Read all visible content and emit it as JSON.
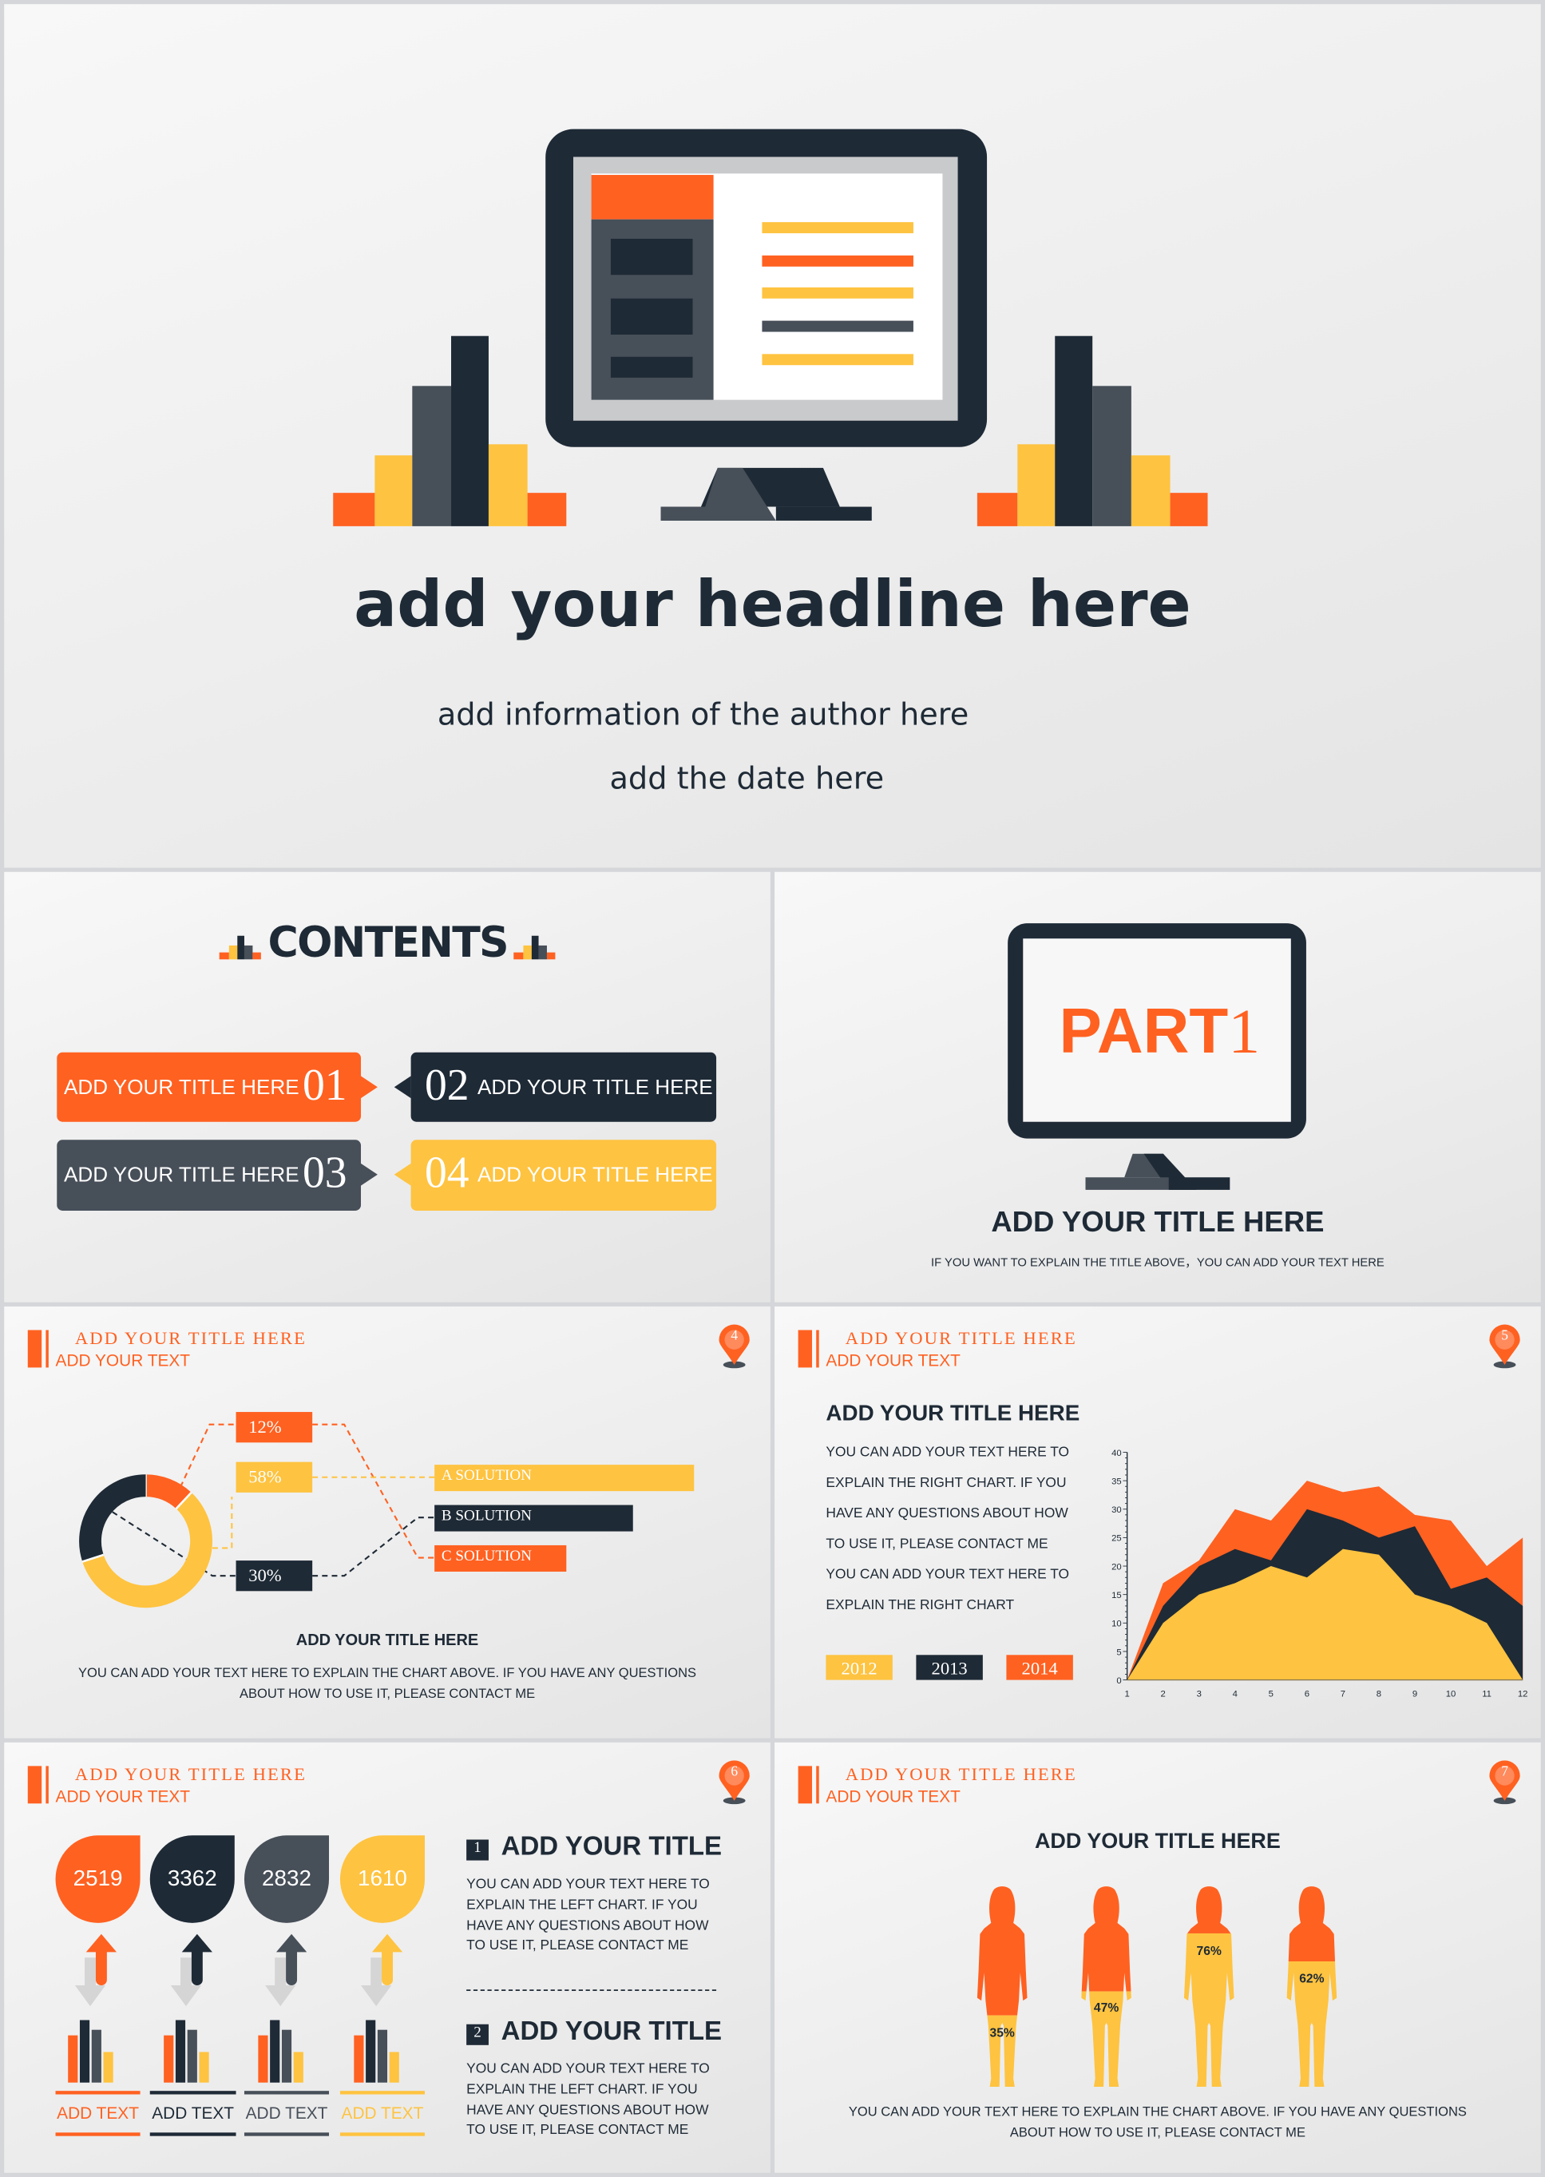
{
  "colors": {
    "orange": "#ff6121",
    "yellow": "#fec340",
    "dark": "#1e2a36",
    "gray": "#474f59"
  },
  "slide1": {
    "headline": "add your headline here",
    "author": "add information of the author here",
    "date": "add the date here"
  },
  "slide2": {
    "title": "CONTENTS",
    "items": [
      {
        "label": "ADD YOUR TITLE HERE",
        "number": "01"
      },
      {
        "label": "ADD YOUR TITLE HERE",
        "number": "02"
      },
      {
        "label": "ADD YOUR TITLE HERE",
        "number": "03"
      },
      {
        "label": "ADD YOUR TITLE HERE",
        "number": "04"
      }
    ]
  },
  "slide3": {
    "part_word": "PART",
    "part_number": "1",
    "title": "ADD YOUR TITLE HERE",
    "subtitle": "IF YOU WANT TO EXPLAIN THE TITLE ABOVE，YOU CAN ADD YOUR TEXT HERE"
  },
  "slide4": {
    "header_title": "ADD YOUR TITLE HERE",
    "header_text": "ADD YOUR TEXT",
    "page_number": "4",
    "solutions": [
      "A SOLUTION",
      "B SOLUTION",
      "C SOLUTION"
    ],
    "title": "ADD YOUR TITLE HERE",
    "text_lines": [
      "YOU CAN ADD YOUR TEXT HERE TO EXPLAIN THE CHART ABOVE. IF YOU HAVE ANY QUESTIONS",
      "ABOUT HOW TO USE IT, PLEASE CONTACT ME"
    ]
  },
  "slide5": {
    "header_title": "ADD YOUR TITLE HERE",
    "header_text": "ADD YOUR TEXT",
    "page_number": "5",
    "title": "ADD YOUR TITLE HERE",
    "text_lines": [
      "YOU CAN ADD YOUR TEXT  HERE  TO",
      "EXPLAIN THE RIGHT CHART.  IF YOU",
      "HAVE ANY QUESTIONS ABOUT HOW",
      "TO USE IT, PLEASE CONTACT ME",
      "YOU CAN ADD YOUR TEXT  HERE  TO",
      "EXPLAIN THE RIGHT CHART"
    ]
  },
  "slide6": {
    "header_title": "ADD YOUR TITLE HERE",
    "header_text": "ADD YOUR TEXT",
    "page_number": "6",
    "drops": [
      "2519",
      "3362",
      "2832",
      "1610"
    ],
    "labels": [
      "ADD TEXT",
      "ADD TEXT",
      "ADD TEXT",
      "ADD TEXT"
    ],
    "sections": [
      {
        "number": "1",
        "title": "ADD YOUR TITLE",
        "lines": [
          "YOU CAN ADD YOUR TEXT   HERE TO",
          "EXPLAIN THE LEFT CHART.  IF YOU",
          "HAVE ANY QUESTIONS ABOUT HOW",
          "TO USE IT, PLEASE CONTACT ME"
        ]
      },
      {
        "number": "2",
        "title": "ADD YOUR TITLE",
        "lines": [
          "YOU CAN ADD YOUR TEXT   HERE TO",
          "EXPLAIN THE LEFT CHART.  IF YOU",
          "HAVE ANY QUESTIONS ABOUT HOW",
          "TO USE IT, PLEASE CONTACT ME"
        ]
      }
    ]
  },
  "slide7": {
    "header_title": "ADD YOUR TITLE HERE",
    "header_text": "ADD YOUR TEXT",
    "page_number": "7",
    "title": "ADD YOUR TITLE HERE",
    "text_lines": [
      "YOU CAN ADD YOUR TEXT HERE TO EXPLAIN THE CHART ABOVE. IF YOU HAVE ANY QUESTIONS",
      "ABOUT HOW TO USE IT, PLEASE CONTACT ME"
    ]
  },
  "chart_data": [
    {
      "type": "area",
      "stacked": true,
      "x": [
        1,
        2,
        3,
        4,
        5,
        6,
        7,
        8,
        9,
        10,
        11,
        12
      ],
      "ylim": [
        0,
        40
      ],
      "yticks": [
        0,
        5,
        10,
        15,
        20,
        25,
        30,
        35,
        40
      ],
      "series": [
        {
          "name": "2012",
          "color": "#fec340",
          "values": [
            0,
            10,
            15,
            17,
            20,
            18,
            23,
            22,
            15,
            13,
            10,
            0
          ]
        },
        {
          "name": "2013",
          "color": "#1e2a36",
          "values": [
            0,
            3,
            5,
            6,
            1,
            12,
            5,
            3,
            12,
            3,
            8,
            13
          ]
        },
        {
          "name": "2014",
          "color": "#ff6121",
          "values": [
            0,
            4,
            1,
            7,
            7,
            5,
            5,
            9,
            2,
            12,
            2,
            12
          ]
        }
      ]
    },
    {
      "type": "pie",
      "donut": true,
      "values": [
        12,
        58,
        30
      ],
      "labels": [
        "12%",
        "58%",
        "30%"
      ],
      "colors": [
        "#ff6121",
        "#fec340",
        "#1e2a36"
      ]
    },
    {
      "type": "bar",
      "style": "figure-fill",
      "values": [
        35,
        47,
        76,
        62
      ],
      "labels": [
        "35%",
        "47%",
        "76%",
        "62%"
      ]
    }
  ]
}
